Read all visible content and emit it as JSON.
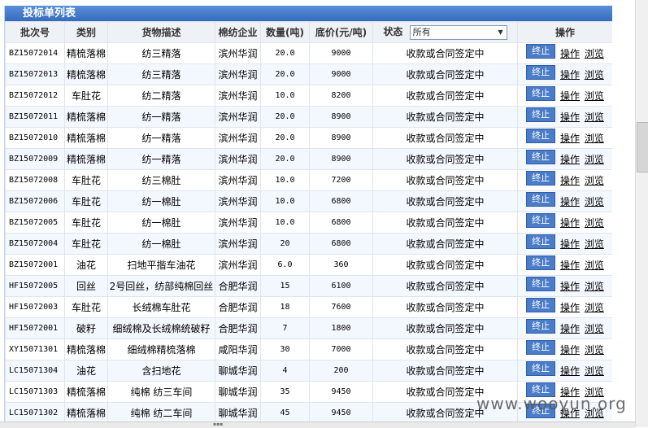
{
  "title": "投标单列表",
  "columns": {
    "batch": "批次号",
    "category": "类别",
    "description": "货物描述",
    "company": "棉纺企业",
    "quantity": "数量(吨)",
    "price": "底价(元/吨)",
    "status": "状态",
    "action": "操作"
  },
  "status_filter": {
    "selected": "所有"
  },
  "row_action_labels": {
    "stop": "终止",
    "operate": "操作",
    "browse": "浏览"
  },
  "rows": [
    {
      "batch": "BZ15072014",
      "category": "精梳落棉",
      "description": "纺三精落",
      "company": "滨州华润",
      "quantity": "20.0",
      "price": "9000",
      "status": "收款或合同签定中"
    },
    {
      "batch": "BZ15072013",
      "category": "精梳落棉",
      "description": "纺三精落",
      "company": "滨州华润",
      "quantity": "20.0",
      "price": "9000",
      "status": "收款或合同签定中"
    },
    {
      "batch": "BZ15072012",
      "category": "车肚花",
      "description": "纺二精落",
      "company": "滨州华润",
      "quantity": "10.0",
      "price": "8200",
      "status": "收款或合同签定中"
    },
    {
      "batch": "BZ15072011",
      "category": "精梳落棉",
      "description": "纺一精落",
      "company": "滨州华润",
      "quantity": "20.0",
      "price": "8900",
      "status": "收款或合同签定中"
    },
    {
      "batch": "BZ15072010",
      "category": "精梳落棉",
      "description": "纺一精落",
      "company": "滨州华润",
      "quantity": "20.0",
      "price": "8900",
      "status": "收款或合同签定中"
    },
    {
      "batch": "BZ15072009",
      "category": "精梳落棉",
      "description": "纺一精落",
      "company": "滨州华润",
      "quantity": "20.0",
      "price": "8900",
      "status": "收款或合同签定中"
    },
    {
      "batch": "BZ15072008",
      "category": "车肚花",
      "description": "纺三棉肚",
      "company": "滨州华润",
      "quantity": "10.0",
      "price": "7200",
      "status": "收款或合同签定中"
    },
    {
      "batch": "BZ15072006",
      "category": "车肚花",
      "description": "纺一棉肚",
      "company": "滨州华润",
      "quantity": "10.0",
      "price": "6800",
      "status": "收款或合同签定中"
    },
    {
      "batch": "BZ15072005",
      "category": "车肚花",
      "description": "纺一棉肚",
      "company": "滨州华润",
      "quantity": "10.0",
      "price": "6800",
      "status": "收款或合同签定中"
    },
    {
      "batch": "BZ15072004",
      "category": "车肚花",
      "description": "纺一棉肚",
      "company": "滨州华润",
      "quantity": "20",
      "price": "6800",
      "status": "收款或合同签定中"
    },
    {
      "batch": "BZ15072001",
      "category": "油花",
      "description": "扫地平揩车油花",
      "company": "滨州华润",
      "quantity": "6.0",
      "price": "360",
      "status": "收款或合同签定中"
    },
    {
      "batch": "HF15072005",
      "category": "回丝",
      "description": "2号回丝，纺部纯棉回丝",
      "company": "合肥华润",
      "quantity": "15",
      "price": "6100",
      "status": "收款或合同签定中"
    },
    {
      "batch": "HF15072003",
      "category": "车肚花",
      "description": "长绒棉车肚花",
      "company": "合肥华润",
      "quantity": "18",
      "price": "7600",
      "status": "收款或合同签定中"
    },
    {
      "batch": "HF15072001",
      "category": "破籽",
      "description": "细绒棉及长绒棉统破籽",
      "company": "合肥华润",
      "quantity": "7",
      "price": "1800",
      "status": "收款或合同签定中"
    },
    {
      "batch": "XY15071301",
      "category": "精梳落棉",
      "description": "细绒棉精梳落棉",
      "company": "咸阳华润",
      "quantity": "30",
      "price": "7000",
      "status": "收款或合同签定中"
    },
    {
      "batch": "LC15071304",
      "category": "油花",
      "description": "含扫地花",
      "company": "聊城华润",
      "quantity": "4",
      "price": "200",
      "status": "收款或合同签定中"
    },
    {
      "batch": "LC15071303",
      "category": "精梳落棉",
      "description": "纯棉 纺三车间",
      "company": "聊城华润",
      "quantity": "35",
      "price": "9450",
      "status": "收款或合同签定中"
    },
    {
      "batch": "LC15071302",
      "category": "精梳落棉",
      "description": "纯棉 纺二车间",
      "company": "聊城华润",
      "quantity": "45",
      "price": "9450",
      "status": "收款或合同签定中"
    }
  ],
  "watermark": "www.wooyun.org"
}
